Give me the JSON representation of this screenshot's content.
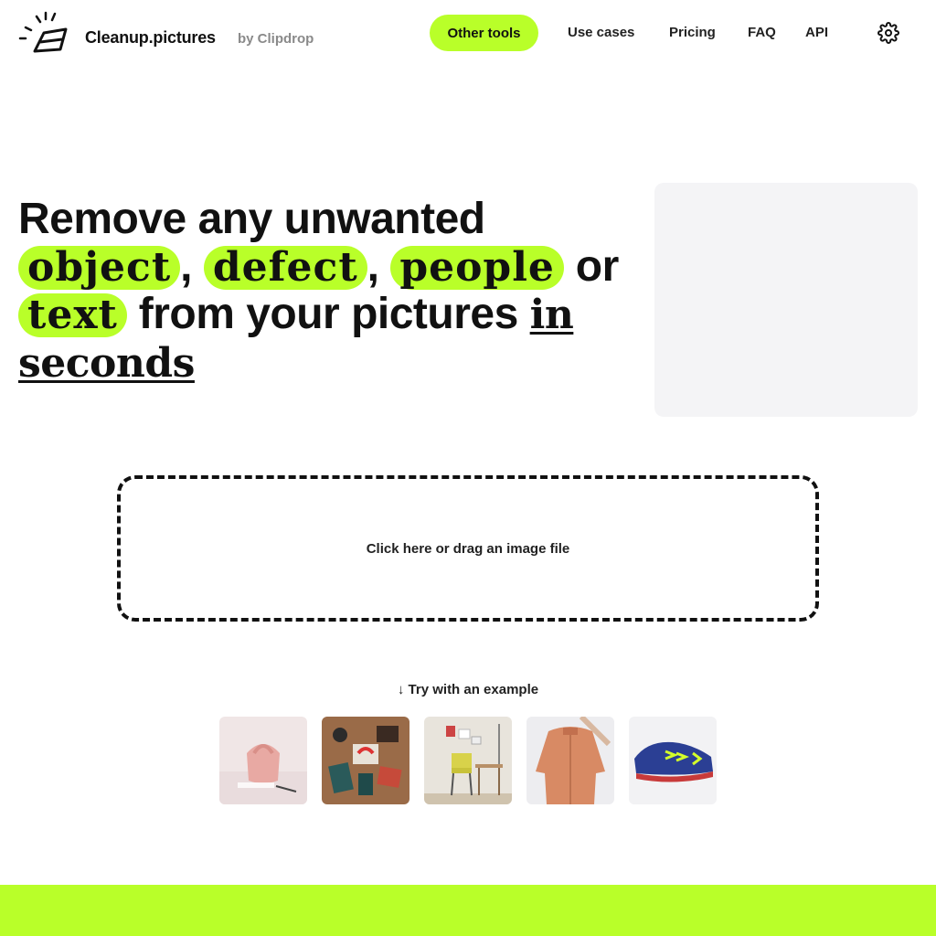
{
  "header": {
    "brand": "Cleanup.pictures",
    "byline": "by Clipdrop",
    "nav": {
      "other_tools": "Other tools",
      "use_cases": "Use cases",
      "pricing": "Pricing",
      "faq": "FAQ",
      "api": "API"
    },
    "settings_icon": "gear-icon"
  },
  "hero": {
    "line1": "Remove any unwanted",
    "word_object": "object",
    "comma1": ",",
    "word_defect": "defect",
    "comma2": ",",
    "word_people": "people",
    "word_or": "or",
    "word_text": "text",
    "middle": "from your pictures",
    "underlined": "in seconds"
  },
  "upload": {
    "label": "Click here or drag an image file"
  },
  "examples": {
    "label": "Try with an example",
    "arrow_icon": "arrow-down-icon",
    "items": [
      "pink-bag-photo",
      "desk-stationery-photo",
      "workspace-chair-photo",
      "orange-jacket-photo",
      "blue-sneaker-photo"
    ]
  },
  "colors": {
    "accent": "#b9ff29",
    "text": "#111111",
    "muted": "#8a8a8a",
    "preview_bg": "#f4f4f6"
  }
}
